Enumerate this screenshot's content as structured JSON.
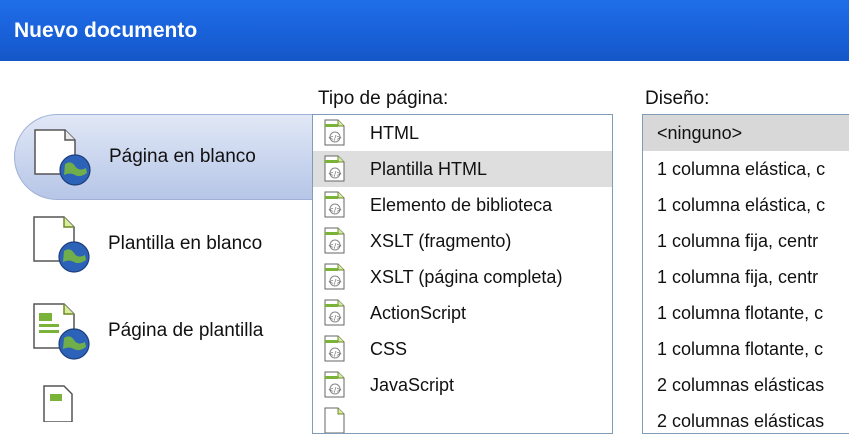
{
  "window": {
    "title": "Nuevo documento"
  },
  "categories": [
    {
      "label": "Página en blanco",
      "icon": "blank-page-globe-icon",
      "selected": true
    },
    {
      "label": "Plantilla en blanco",
      "icon": "blank-template-globe-icon",
      "selected": false
    },
    {
      "label": "Página de plantilla",
      "icon": "template-page-globe-icon",
      "selected": false
    }
  ],
  "page_type": {
    "heading": "Tipo de página:",
    "items": [
      {
        "label": "HTML",
        "selected": false
      },
      {
        "label": "Plantilla HTML",
        "selected": true
      },
      {
        "label": "Elemento de biblioteca",
        "selected": false
      },
      {
        "label": "XSLT (fragmento)",
        "selected": false
      },
      {
        "label": "XSLT (página completa)",
        "selected": false
      },
      {
        "label": "ActionScript",
        "selected": false
      },
      {
        "label": "CSS",
        "selected": false
      },
      {
        "label": "JavaScript",
        "selected": false
      }
    ]
  },
  "layout": {
    "heading": "Diseño:",
    "items": [
      {
        "label": "<ninguno>",
        "selected": true
      },
      {
        "label": "1 columna elástica, c",
        "selected": false
      },
      {
        "label": "1 columna elástica, c",
        "selected": false
      },
      {
        "label": "1 columna fija, centr",
        "selected": false
      },
      {
        "label": "1 columna fija, centr",
        "selected": false
      },
      {
        "label": "1 columna flotante, c",
        "selected": false
      },
      {
        "label": "1 columna flotante, c",
        "selected": false
      },
      {
        "label": "2 columnas elásticas",
        "selected": false
      },
      {
        "label": "2 columnas elásticas",
        "selected": false
      }
    ]
  },
  "colors": {
    "titlebar": "#1a63dc",
    "selection": "#dedede",
    "panel_border": "#7f9db9"
  }
}
